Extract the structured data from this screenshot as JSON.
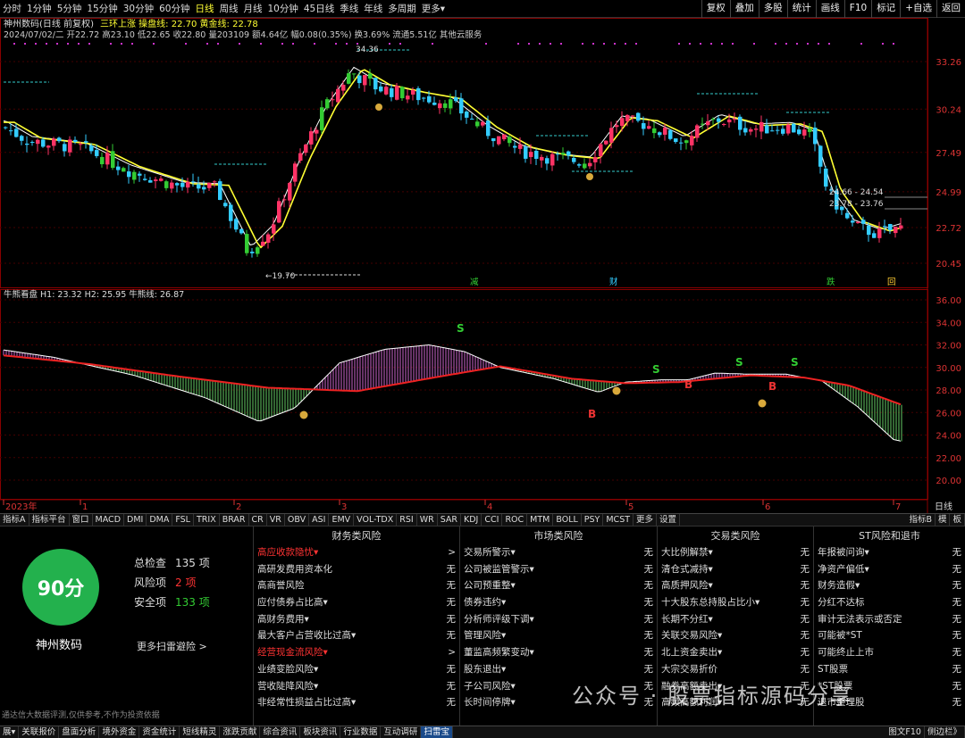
{
  "topbar": {
    "periods": [
      "分时",
      "1分钟",
      "5分钟",
      "15分钟",
      "30分钟",
      "60分钟",
      "日线",
      "周线",
      "月线",
      "10分钟",
      "45日线",
      "季线",
      "年线",
      "多周期",
      "更多▾"
    ],
    "active_period": "日线",
    "tools": [
      "复权",
      "叠加",
      "多股",
      "统计",
      "画线",
      "F10",
      "标记",
      "+自选",
      "返回"
    ]
  },
  "main_chart": {
    "title": "神州数码(日线 前复权)",
    "indicator_line": "三环上涨  操盘线: 22.70  黄金线: 22.78",
    "info_line": "2024/07/02/二 开22.72 高23.10 低22.65 收22.80 量203109 额4.64亿 幅0.08(0.35%) 换3.69% 流通5.51亿 其他云服务",
    "price_ticks": [
      "33.26",
      "30.24",
      "27.49",
      "24.99",
      "22.72",
      "20.45"
    ],
    "annotations": {
      "high": "34.36",
      "low": "19.70",
      "box1": "24.66 - 24.54",
      "box2": "23.78 - 23.76"
    },
    "event_labels": [
      "减",
      "财",
      "跌",
      "回"
    ]
  },
  "sub_chart": {
    "title": "牛熊看盘  H1: 23.32  H2: 25.95  牛熊线: 26.87",
    "ticks": [
      "36.00",
      "34.00",
      "32.00",
      "30.00",
      "28.00",
      "26.00",
      "24.00",
      "22.00",
      "20.00"
    ],
    "signals": [
      "S",
      "S",
      "S",
      "S",
      "B",
      "B",
      "B"
    ]
  },
  "x_axis": {
    "labels": [
      "2023年",
      "1",
      "2",
      "3",
      "4",
      "5",
      "6",
      "7"
    ],
    "right_label": "日线"
  },
  "indicator_tabs": [
    "指标A",
    "指标平台",
    "窗口",
    "MACD",
    "DMI",
    "DMA",
    "FSL",
    "TRIX",
    "BRAR",
    "CR",
    "VR",
    "OBV",
    "ASI",
    "EMV",
    "VOL-TDX",
    "RSI",
    "WR",
    "SAR",
    "KDJ",
    "CCI",
    "ROC",
    "MTM",
    "BOLL",
    "PSY",
    "MCST",
    "更多",
    "设置"
  ],
  "indicator_tabs_right": [
    "指标B",
    "模",
    "板"
  ],
  "scan": {
    "score": "90分",
    "stock_name": "神州数码",
    "total_label": "总检查",
    "total_value": "135 项",
    "risk_label": "风险项",
    "risk_value": "2 项",
    "safe_label": "安全项",
    "safe_value": "133 项",
    "more": "更多扫雷避险 >",
    "disclaimer": "通达信大数据评测,仅供参考,不作为投资依据"
  },
  "risk_columns": [
    {
      "title": "财务类风险",
      "rows": [
        {
          "label": "高应收款隐忧▾",
          "value": ">",
          "hl": true
        },
        {
          "label": "高研发费用资本化",
          "value": "无"
        },
        {
          "label": "高商誉风险",
          "value": "无"
        },
        {
          "label": "应付债券占比高▾",
          "value": "无"
        },
        {
          "label": "高财务费用▾",
          "value": "无"
        },
        {
          "label": "最大客户占营收比过高▾",
          "value": "无"
        },
        {
          "label": "经营现金流风险▾",
          "value": ">",
          "hl": true
        },
        {
          "label": "业绩变脸风险▾",
          "value": "无"
        },
        {
          "label": "营收陡降风险▾",
          "value": "无"
        },
        {
          "label": "非经常性损益占比过高▾",
          "value": "无"
        }
      ]
    },
    {
      "title": "市场类风险",
      "rows": [
        {
          "label": "交易所警示▾",
          "value": "无"
        },
        {
          "label": "公司被监管警示▾",
          "value": "无"
        },
        {
          "label": "公司预重整▾",
          "value": "无"
        },
        {
          "label": "债券违约▾",
          "value": "无"
        },
        {
          "label": "分析师评级下调▾",
          "value": "无"
        },
        {
          "label": "管理风险▾",
          "value": "无"
        },
        {
          "label": "董监高频繁变动▾",
          "value": "无"
        },
        {
          "label": "股东退出▾",
          "value": "无"
        },
        {
          "label": "子公司风险▾",
          "value": "无"
        },
        {
          "label": "长时间停牌▾",
          "value": "无"
        }
      ]
    },
    {
      "title": "交易类风险",
      "rows": [
        {
          "label": "大比例解禁▾",
          "value": "无"
        },
        {
          "label": "清仓式减持▾",
          "value": "无"
        },
        {
          "label": "高质押风险▾",
          "value": "无"
        },
        {
          "label": "十大股东总持股占比小▾",
          "value": "无"
        },
        {
          "label": "长期不分红▾",
          "value": "无"
        },
        {
          "label": "关联交易风险▾",
          "value": "无"
        },
        {
          "label": "北上资金卖出▾",
          "value": "无"
        },
        {
          "label": "大宗交易折价",
          "value": "无"
        },
        {
          "label": "融券高额卖出▾",
          "value": "无"
        },
        {
          "label": "高频高额利润▾",
          "value": "无"
        }
      ]
    },
    {
      "title": "ST风险和退市",
      "rows": [
        {
          "label": "年报被问询▾",
          "value": "无"
        },
        {
          "label": "净资产偏低▾",
          "value": "无"
        },
        {
          "label": "财务造假▾",
          "value": "无"
        },
        {
          "label": "分红不达标",
          "value": "无"
        },
        {
          "label": "审计无法表示或否定",
          "value": "无"
        },
        {
          "label": "可能被*ST",
          "value": "无"
        },
        {
          "label": "可能终止上市",
          "value": "无"
        },
        {
          "label": "ST股票",
          "value": "无"
        },
        {
          "label": "*ST股票",
          "value": "无"
        },
        {
          "label": "退市整理股",
          "value": "无"
        }
      ]
    }
  ],
  "watermark": "公众号 · 股票指标源码分享",
  "bottom_tabs": [
    "展▾",
    "关联报价",
    "盘面分析",
    "境外资金",
    "资金统计",
    "短线精灵",
    "涨跌贡献",
    "综合资讯",
    "板块资讯",
    "行业数据",
    "互动调研",
    "扫雷宝"
  ],
  "bottom_active": "扫雷宝",
  "bottom_right": [
    "图文F10",
    "侧边栏》"
  ]
}
